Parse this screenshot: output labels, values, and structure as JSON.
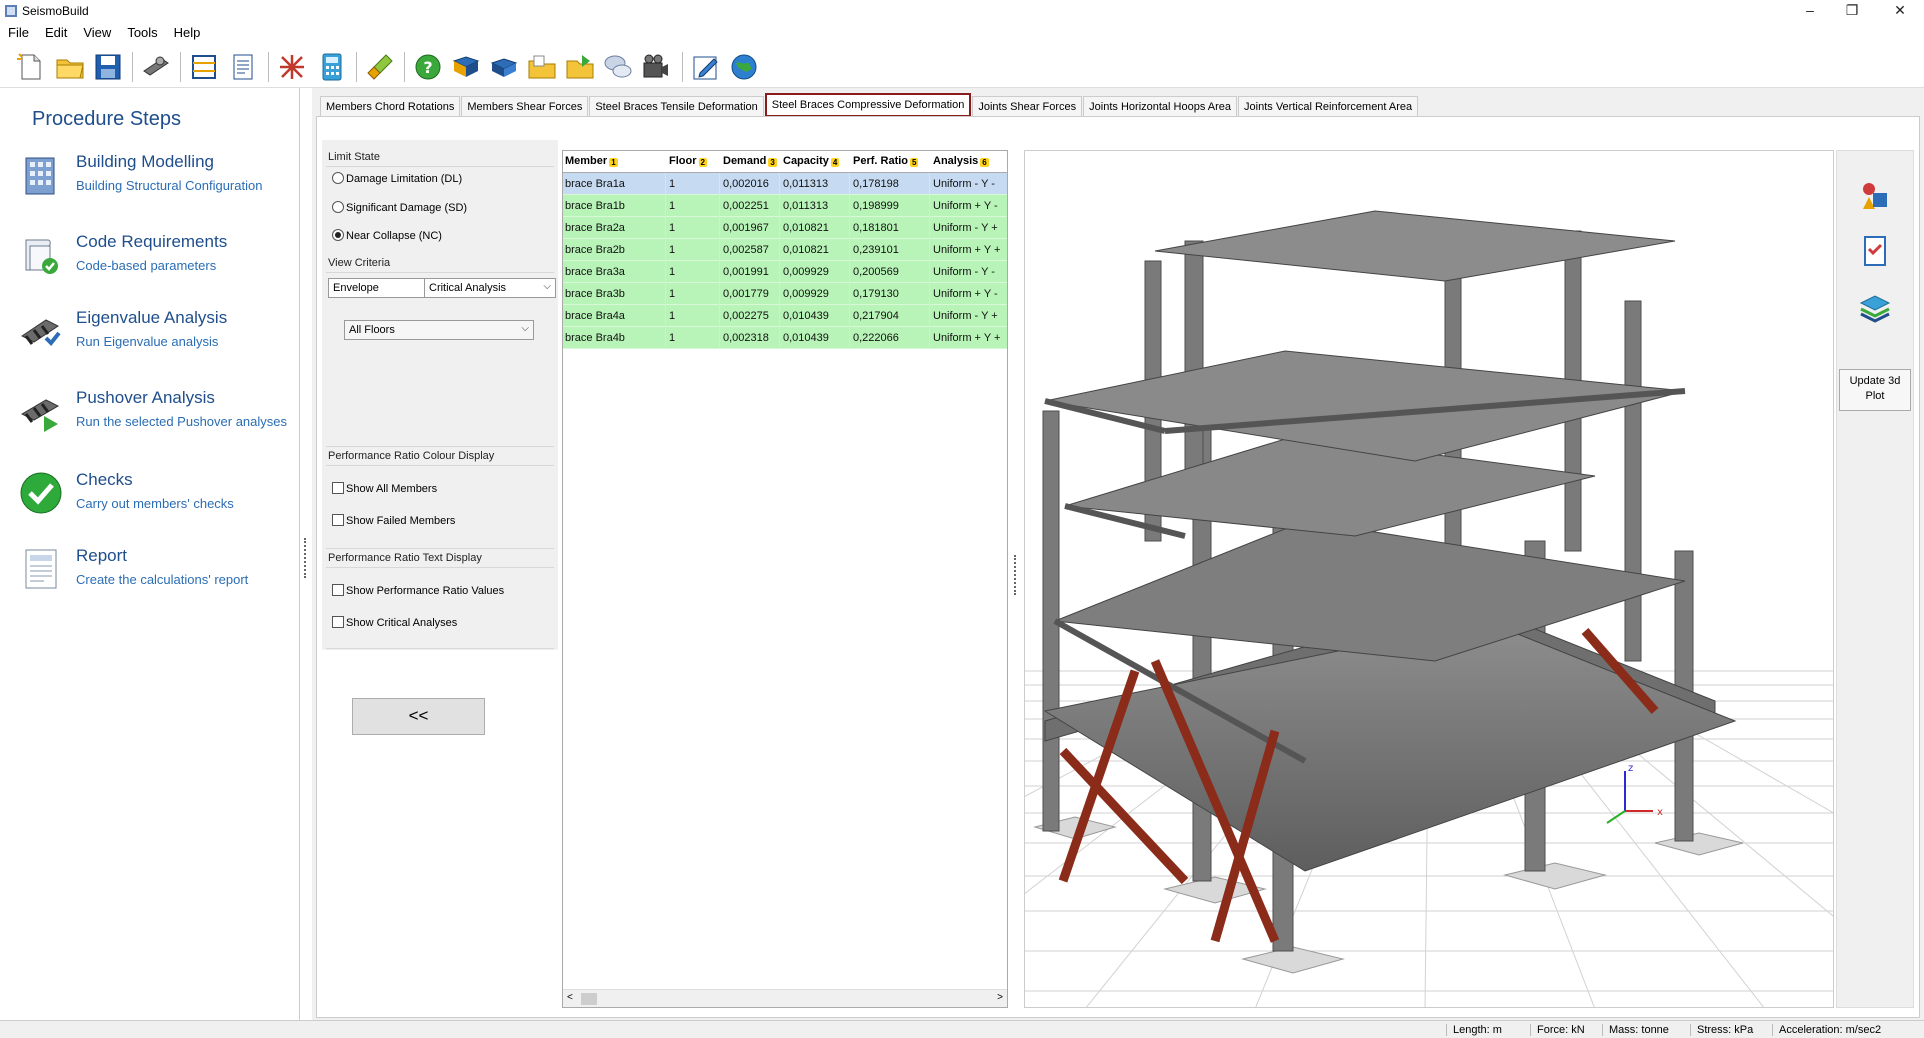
{
  "app": {
    "title": "SeismoBuild"
  },
  "menu": [
    "File",
    "Edit",
    "View",
    "Tools",
    "Help"
  ],
  "toolbar": {
    "icons": [
      "new-file-icon",
      "open-folder-icon",
      "save-icon",
      "settings-icon",
      "frame-icon",
      "report-doc-icon",
      "structure-icon",
      "calculator-icon",
      "brush-icon",
      "help-icon",
      "book-icon",
      "book-2-icon",
      "folder-icon",
      "folder-2-icon",
      "chat-icon",
      "video-icon",
      "edit-icon",
      "globe-icon"
    ]
  },
  "procedure": {
    "heading": "Procedure Steps",
    "steps": [
      {
        "name": "Building Modelling",
        "sub": "Building Structural Configuration"
      },
      {
        "name": "Code Requirements",
        "sub": "Code-based parameters"
      },
      {
        "name": "Eigenvalue Analysis",
        "sub": "Run Eigenvalue analysis"
      },
      {
        "name": "Pushover Analysis",
        "sub": "Run the selected Pushover analyses"
      },
      {
        "name": "Checks",
        "sub": "Carry out members' checks"
      },
      {
        "name": "Report",
        "sub": "Create the calculations' report"
      }
    ]
  },
  "tabs": [
    "Members Chord Rotations",
    "Members Shear Forces",
    "Steel Braces Tensile Deformation",
    "Steel Braces Compressive Deformation",
    "Joints Shear Forces",
    "Joints Horizontal Hoops Area",
    "Joints Vertical Reinforcement Area"
  ],
  "selected_tab": "Steel Braces Compressive Deformation",
  "controls": {
    "limit_state_label": "Limit State",
    "limit_states": [
      "Damage Limitation (DL)",
      "Significant Damage (SD)",
      "Near Collapse (NC)"
    ],
    "selected_limit_state": "Near Collapse (NC)",
    "view_criteria_label": "View Criteria",
    "envelope": "Envelope",
    "critical": "Critical Analysis",
    "floors": "All Floors",
    "colour_display_label": "Performance Ratio Colour Display",
    "show_all": "Show All Members",
    "show_failed": "Show Failed Members",
    "text_display_label": "Performance Ratio Text Display",
    "show_values": "Show Performance Ratio Values",
    "show_critical": "Show Critical Analyses",
    "back_button": "<<"
  },
  "table": {
    "headers": [
      {
        "label": "Member",
        "n": "1"
      },
      {
        "label": "Floor",
        "n": "2"
      },
      {
        "label": "Demand",
        "n": "3"
      },
      {
        "label": "Capacity",
        "n": "4"
      },
      {
        "label": "Perf. Ratio",
        "n": "5"
      },
      {
        "label": "Analysis",
        "n": "6"
      }
    ],
    "rows": [
      [
        "brace Bra1a",
        "1",
        "0,002016",
        "0,011313",
        "0,178198",
        "Uniform - Y -"
      ],
      [
        "brace Bra1b",
        "1",
        "0,002251",
        "0,011313",
        "0,198999",
        "Uniform + Y -"
      ],
      [
        "brace Bra2a",
        "1",
        "0,001967",
        "0,010821",
        "0,181801",
        "Uniform - Y +"
      ],
      [
        "brace Bra2b",
        "1",
        "0,002587",
        "0,010821",
        "0,239101",
        "Uniform + Y +"
      ],
      [
        "brace Bra3a",
        "1",
        "0,001991",
        "0,009929",
        "0,200569",
        "Uniform - Y -"
      ],
      [
        "brace Bra3b",
        "1",
        "0,001779",
        "0,009929",
        "0,179130",
        "Uniform + Y -"
      ],
      [
        "brace Bra4a",
        "1",
        "0,002275",
        "0,010439",
        "0,217904",
        "Uniform - Y +"
      ],
      [
        "brace Bra4b",
        "1",
        "0,002318",
        "0,010439",
        "0,222066",
        "Uniform + Y +"
      ]
    ],
    "scroll_left": "<",
    "scroll_right": ">"
  },
  "view3d": {
    "update_label": "Update 3d Plot",
    "axis_x": "x",
    "axis_z": "z",
    "side_icons": [
      "shapes-icon",
      "checklist-icon",
      "layers-icon"
    ]
  },
  "status": {
    "length": "Length: m",
    "force": "Force: kN",
    "mass": "Mass: tonne",
    "stress": "Stress: kPa",
    "accel": "Acceleration: m/sec2"
  },
  "colors": {
    "pass_row": "#b8f4b8",
    "selected_row": "#c6dbf2",
    "tab_border": "#8b1a1a",
    "brace": "#8b2b1a",
    "link": "#1f4e8c"
  }
}
